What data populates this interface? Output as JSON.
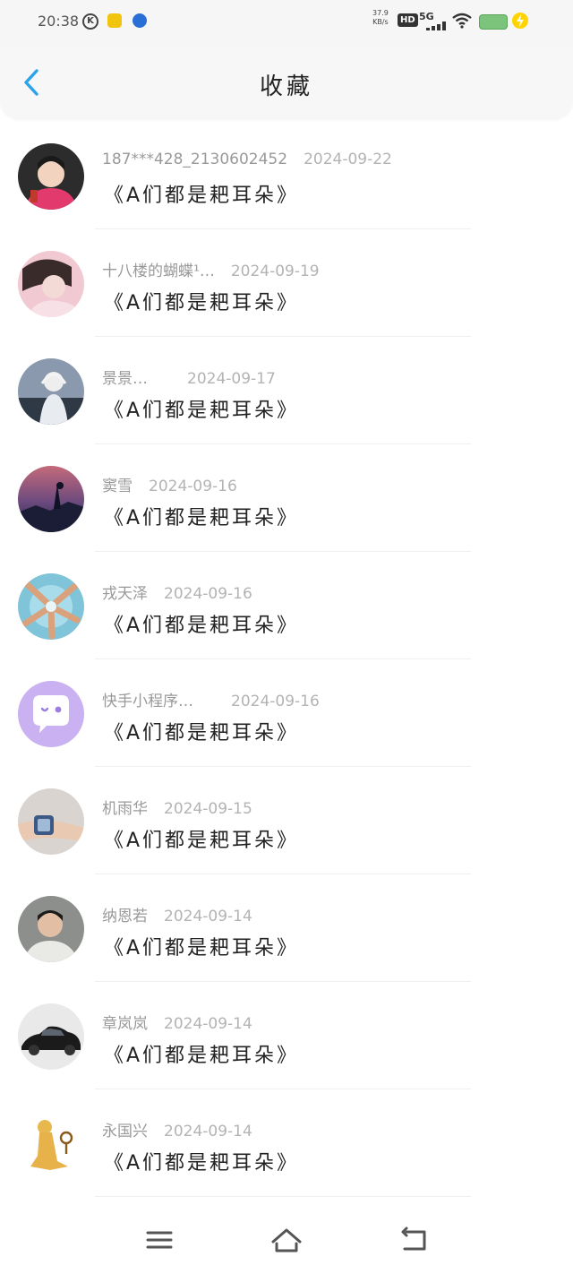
{
  "status_bar": {
    "time": "20:38",
    "speed_value": "37.9",
    "speed_unit": "KB/s",
    "hd_label": "HD",
    "network_label": "5G"
  },
  "header": {
    "title": "收藏",
    "back_icon": "chevron-left-icon",
    "accent_color": "#2aa3e8"
  },
  "favorites": [
    {
      "user": "187***428_2130602452",
      "date": "2024-09-22",
      "title": "《A们都是耙耳朵》"
    },
    {
      "user": "十八楼的蝴蝶¹…",
      "date": "2024-09-19",
      "title": "《A们都是耙耳朵》"
    },
    {
      "user": "景景…",
      "date": "2024-09-17",
      "title": "《A们都是耙耳朵》"
    },
    {
      "user": "窦雪",
      "date": "2024-09-16",
      "title": "《A们都是耙耳朵》"
    },
    {
      "user": "戎天泽",
      "date": "2024-09-16",
      "title": "《A们都是耙耳朵》"
    },
    {
      "user": "快手小程序…",
      "date": "2024-09-16",
      "title": "《A们都是耙耳朵》"
    },
    {
      "user": "机雨华",
      "date": "2024-09-15",
      "title": "《A们都是耙耳朵》"
    },
    {
      "user": "纳恩若",
      "date": "2024-09-14",
      "title": "《A们都是耙耳朵》"
    },
    {
      "user": "章岚岚",
      "date": "2024-09-14",
      "title": "《A们都是耙耳朵》"
    },
    {
      "user": "永国兴",
      "date": "2024-09-14",
      "title": "《A们都是耙耳朵》"
    }
  ],
  "bottom_nav": {
    "menu_icon": "menu-icon",
    "home_icon": "home-icon",
    "back_icon": "back-arrow-icon"
  }
}
